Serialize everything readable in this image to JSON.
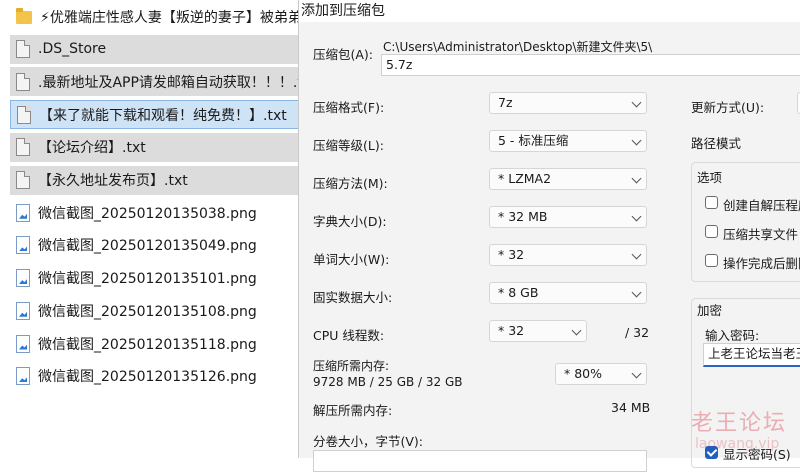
{
  "files": [
    {
      "name": "⚡优雅端庄性感人妻【叛逆的妻子】被弟弟",
      "icon": "folder-icon",
      "style": "plain"
    },
    {
      "name": ".DS_Store",
      "icon": "document-icon",
      "style": "grey"
    },
    {
      "name": ".最新地址及APP请发邮箱自动获取！！！.t",
      "icon": "document-icon",
      "style": "grey"
    },
    {
      "name": "【来了就能下载和观看！纯免费！】.txt",
      "icon": "document-icon",
      "style": "selected"
    },
    {
      "name": "【论坛介绍】.txt",
      "icon": "document-icon",
      "style": "grey"
    },
    {
      "name": "【永久地址发布页】.txt",
      "icon": "document-icon",
      "style": "grey"
    },
    {
      "name": "微信截图_20250120135038.png",
      "icon": "image-file-icon",
      "style": "plain"
    },
    {
      "name": "微信截图_20250120135049.png",
      "icon": "image-file-icon",
      "style": "plain"
    },
    {
      "name": "微信截图_20250120135101.png",
      "icon": "image-file-icon",
      "style": "plain"
    },
    {
      "name": "微信截图_20250120135108.png",
      "icon": "image-file-icon",
      "style": "plain"
    },
    {
      "name": "微信截图_20250120135118.png",
      "icon": "image-file-icon",
      "style": "plain"
    },
    {
      "name": "微信截图_20250120135126.png",
      "icon": "image-file-icon",
      "style": "plain"
    }
  ],
  "dialog": {
    "title": "添加到压缩包",
    "archive_label": "压缩包(A):",
    "archive_path": "C:\\Users\\Administrator\\Desktop\\新建文件夹\\5\\",
    "archive_name": "5.7z",
    "format_label": "压缩格式(F):",
    "format_value": "7z",
    "level_label": "压缩等级(L):",
    "level_value": "5 - 标准压缩",
    "method_label": "压缩方法(M):",
    "method_value": "*  LZMA2",
    "dict_label": "字典大小(D):",
    "dict_value": "*  32 MB",
    "word_label": "单词大小(W):",
    "word_value": "*  32",
    "solid_label": "固实数据大小:",
    "solid_value": "*  8 GB",
    "threads_label": "CPU 线程数:",
    "threads_value": "*  32",
    "threads_total": "/ 32",
    "mem_compress_label": "压缩所需内存:",
    "mem_compress_value": "9728 MB / 25 GB / 32 GB",
    "mem_percent": "*  80%",
    "mem_decompress_label": "解压所需内存:",
    "mem_decompress_value": "34 MB",
    "volume_label": "分卷大小，字节(V):",
    "update_label": "更新方式(U):",
    "path_mode_label": "路径模式",
    "options_label": "选项",
    "opt_sfx": "创建自解压程序",
    "opt_shared": "压缩共享文件",
    "opt_delete": "操作完成后删除",
    "encrypt_label": "加密",
    "password_label": "输入密码:",
    "password_value": "上老王论坛当老王",
    "show_password": "显示密码(S)",
    "watermark": "老王论坛",
    "watermark_url": "laowang.vip"
  },
  "colors": {
    "selected_row": "#cfe3f7",
    "grey_row": "#dcdcdc",
    "accent": "#1f5fbf"
  }
}
